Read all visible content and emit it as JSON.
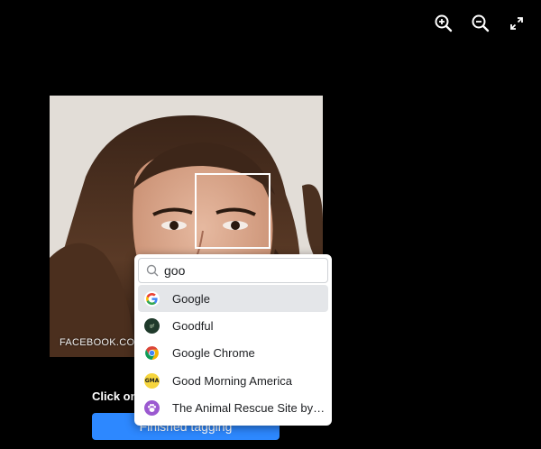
{
  "toolbar": {
    "zoom_in_icon": "zoom-in-icon",
    "zoom_out_icon": "zoom-out-icon",
    "fullscreen_icon": "fullscreen-icon"
  },
  "photo": {
    "watermark": "FACEBOOK.COM/"
  },
  "instruction": "Click on",
  "finish_button": "Finished tagging",
  "tag_search": {
    "value": "goo",
    "icon": "search-icon",
    "suggestions": [
      {
        "label": "Google",
        "avatar": "google-logo-icon",
        "active": true
      },
      {
        "label": "Goodful",
        "avatar": "goodful-logo-icon",
        "active": false
      },
      {
        "label": "Google Chrome",
        "avatar": "chrome-logo-icon",
        "active": false
      },
      {
        "label": "Good Morning America",
        "avatar": "gma-logo-icon",
        "active": false
      },
      {
        "label": "The Animal Rescue Site by G...",
        "avatar": "paw-icon",
        "active": false
      }
    ]
  },
  "colors": {
    "background": "#000000",
    "accent": "#2d88ff",
    "highlight": "#e4e6e9"
  }
}
